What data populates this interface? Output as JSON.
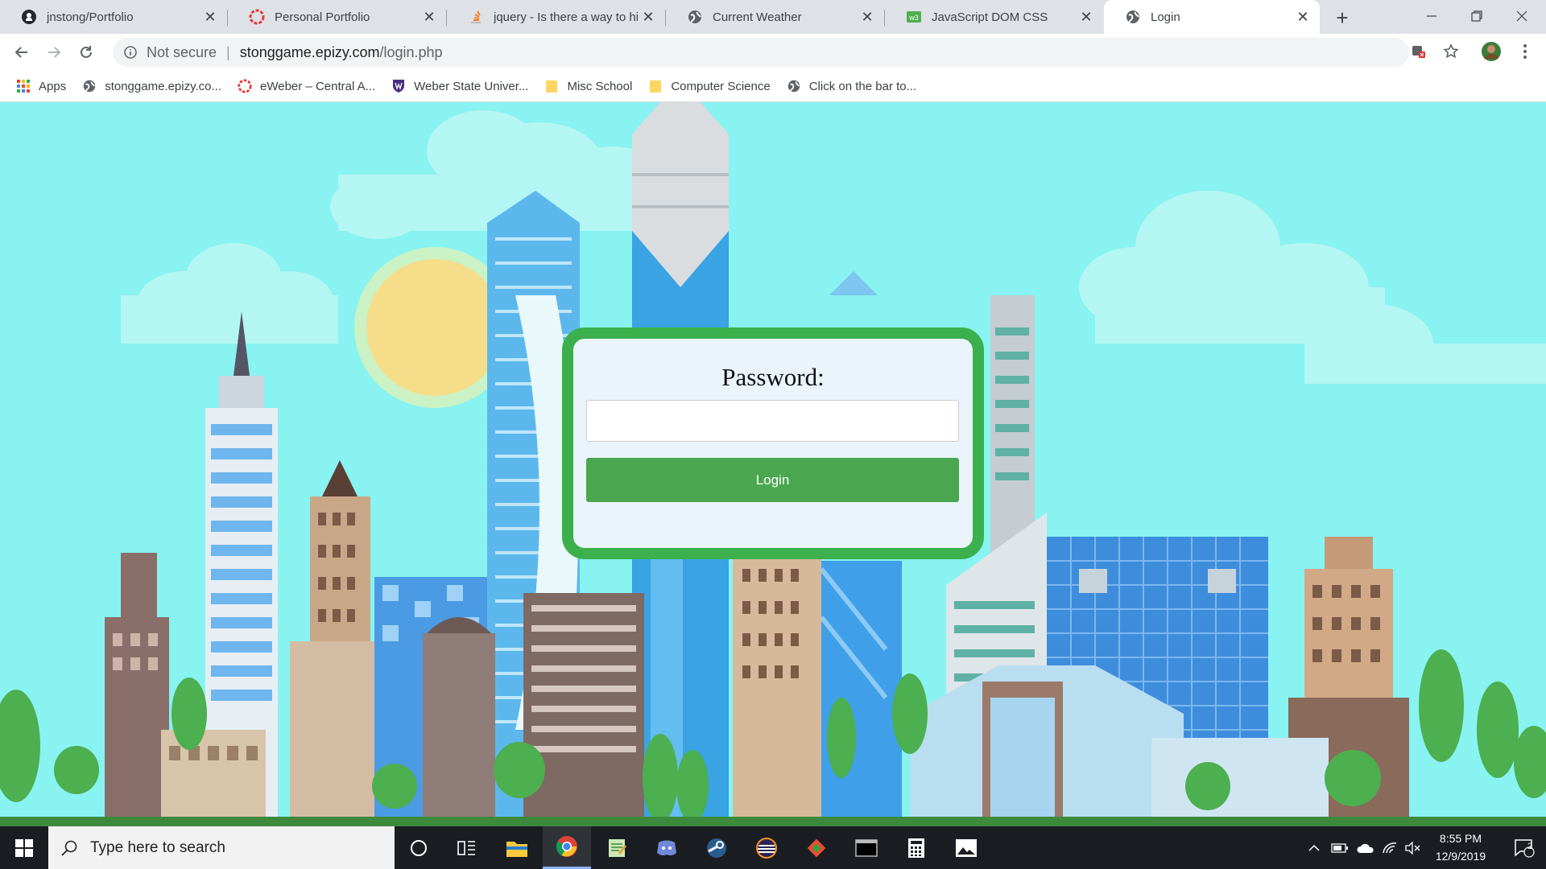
{
  "browser": {
    "tabs": [
      {
        "title": "jnstong/Portfolio",
        "icon": "github-icon"
      },
      {
        "title": "Personal Portfolio",
        "icon": "portfolio-icon"
      },
      {
        "title": "jquery - Is there a way to hide",
        "icon": "stackoverflow-icon"
      },
      {
        "title": "Current Weather",
        "icon": "globe-icon"
      },
      {
        "title": "JavaScript DOM CSS",
        "icon": "w3schools-icon"
      },
      {
        "title": "Login",
        "icon": "globe-icon",
        "active": true
      }
    ],
    "new_tab_label": "+",
    "omnibox": {
      "security_label": "Not secure",
      "url_host": "stonggame.epizy.com",
      "url_path": "/login.php"
    },
    "bookmarks": [
      {
        "label": "Apps",
        "icon": "apps-grid-icon"
      },
      {
        "label": "stonggame.epizy.co...",
        "icon": "globe-icon"
      },
      {
        "label": "eWeber – Central A...",
        "icon": "eweber-icon"
      },
      {
        "label": "Weber State Univer...",
        "icon": "weber-shield-icon"
      },
      {
        "label": "Misc School",
        "icon": "folder-icon"
      },
      {
        "label": "Computer Science",
        "icon": "folder-icon"
      },
      {
        "label": "Click on the bar to...",
        "icon": "globe-icon"
      }
    ]
  },
  "login": {
    "label": "Password:",
    "password_value": "",
    "button_label": "Login"
  },
  "taskbar": {
    "search_placeholder": "Type here to search",
    "time": "8:55 PM",
    "date": "12/9/2019",
    "notification_count": "2",
    "apps": [
      "cortana-icon",
      "task-view-icon",
      "file-explorer-icon",
      "chrome-icon",
      "notepad-icon",
      "discord-icon",
      "steam-icon",
      "eclipse-icon",
      "git-icon",
      "terminal-icon",
      "calculator-icon",
      "photos-icon"
    ]
  },
  "colors": {
    "sky": "#88f3f0",
    "card_border": "#3bb04c",
    "button": "#4aa74f",
    "card_bg": "#ebf3fb"
  }
}
